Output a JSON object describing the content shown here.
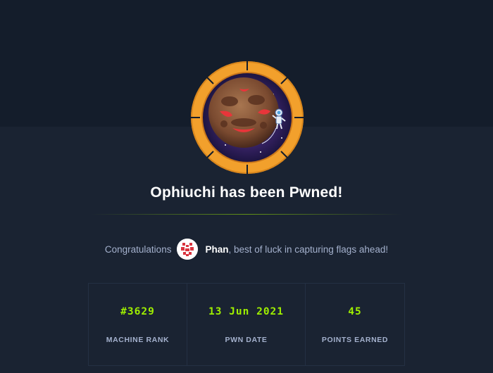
{
  "header": {
    "title": "Ophiuchi has been Pwned!"
  },
  "badge": {
    "icon": "machine-avatar-icon",
    "ring_color": "#f2a02c",
    "planet_color": "#8a5a3c"
  },
  "congrats": {
    "prefix": "Congratulations",
    "username": "Phan",
    "suffix": ", best of luck in capturing flags ahead!"
  },
  "stats": [
    {
      "value": "#3629",
      "label": "MACHINE RANK"
    },
    {
      "value": "13 Jun 2021",
      "label": "PWN DATE"
    },
    {
      "value": "45",
      "label": "POINTS EARNED"
    }
  ],
  "colors": {
    "accent": "#9fef00",
    "background": "#1a2332",
    "header_band": "#141d2b",
    "muted_text": "#a4b1cd"
  }
}
